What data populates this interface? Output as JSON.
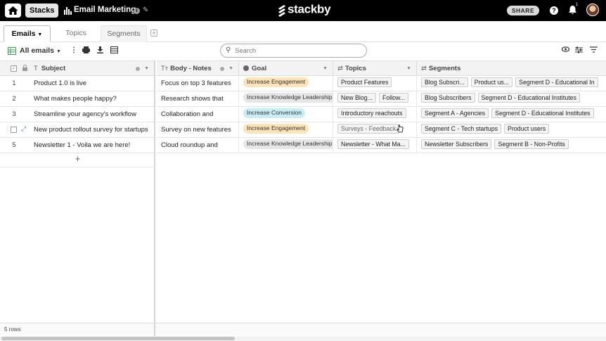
{
  "topbar": {
    "stacks_label": "Stacks",
    "stack_title": "Email Marketing",
    "logo_text": "stackby",
    "share_label": "SHARE",
    "help_label": "?",
    "notification_count": "1"
  },
  "tabs": [
    {
      "label": "Emails",
      "active": true
    },
    {
      "label": "Topics",
      "active": false
    },
    {
      "label": "Segments",
      "active": false
    }
  ],
  "toolbar": {
    "view_label": "All emails",
    "search_placeholder": "Search"
  },
  "columns": [
    {
      "label": "Subject",
      "icon": "text-icon"
    },
    {
      "label": "Body - Notes",
      "icon": "long-text-icon"
    },
    {
      "label": "Goal",
      "icon": "single-select-icon"
    },
    {
      "label": "Topics",
      "icon": "link-icon"
    },
    {
      "label": "Segments",
      "icon": "link-icon"
    }
  ],
  "rows": [
    {
      "num": "1",
      "subject": "Product 1.0 is live",
      "body": "Focus on top 3 features",
      "goal": "Increase Engagement",
      "topics": [
        "Product Features"
      ],
      "segments": [
        "Blog Subscri...",
        "Product us...",
        "Segment D - Educational In"
      ]
    },
    {
      "num": "2",
      "subject": "What makes people happy?",
      "body": "Research shows that",
      "goal": "Increase Knowledge Leadership",
      "topics": [
        "New Blog...",
        "Follow..."
      ],
      "segments": [
        "Blog Subscribers",
        "Segment D - Educational Institutes"
      ]
    },
    {
      "num": "3",
      "subject": "Streamline your agency's workflow",
      "body": "Collaboration and",
      "goal": "Increase Conversion",
      "topics": [
        "Introductory reachouts"
      ],
      "segments": [
        "Segment A - Agencies",
        "Segment D - Educational Institutes"
      ]
    },
    {
      "num": "",
      "subject": "New product rollout survey for startups",
      "body": "Survey on new features",
      "goal": "Increase Engagement",
      "topics": [
        "Surveys - Feedback"
      ],
      "segments": [
        "Segment C - Tech startups",
        "Product users"
      ]
    },
    {
      "num": "5",
      "subject": "Newsletter 1 - Voila we are here!",
      "body": "Cloud roundup and",
      "goal": "Increase Knowledge Leadership",
      "topics": [
        "Newsletter - What Ma..."
      ],
      "segments": [
        "Newsletter Subscribers",
        "Segment B - Non-Profits"
      ]
    }
  ],
  "add_row_label": "+",
  "footer": {
    "row_count": "5 rows"
  },
  "colors": {
    "topbar_bg": "#000000",
    "engagement": "#fde3b8",
    "knowledge": "#e6e6e6",
    "conversion": "#c8eef4"
  }
}
